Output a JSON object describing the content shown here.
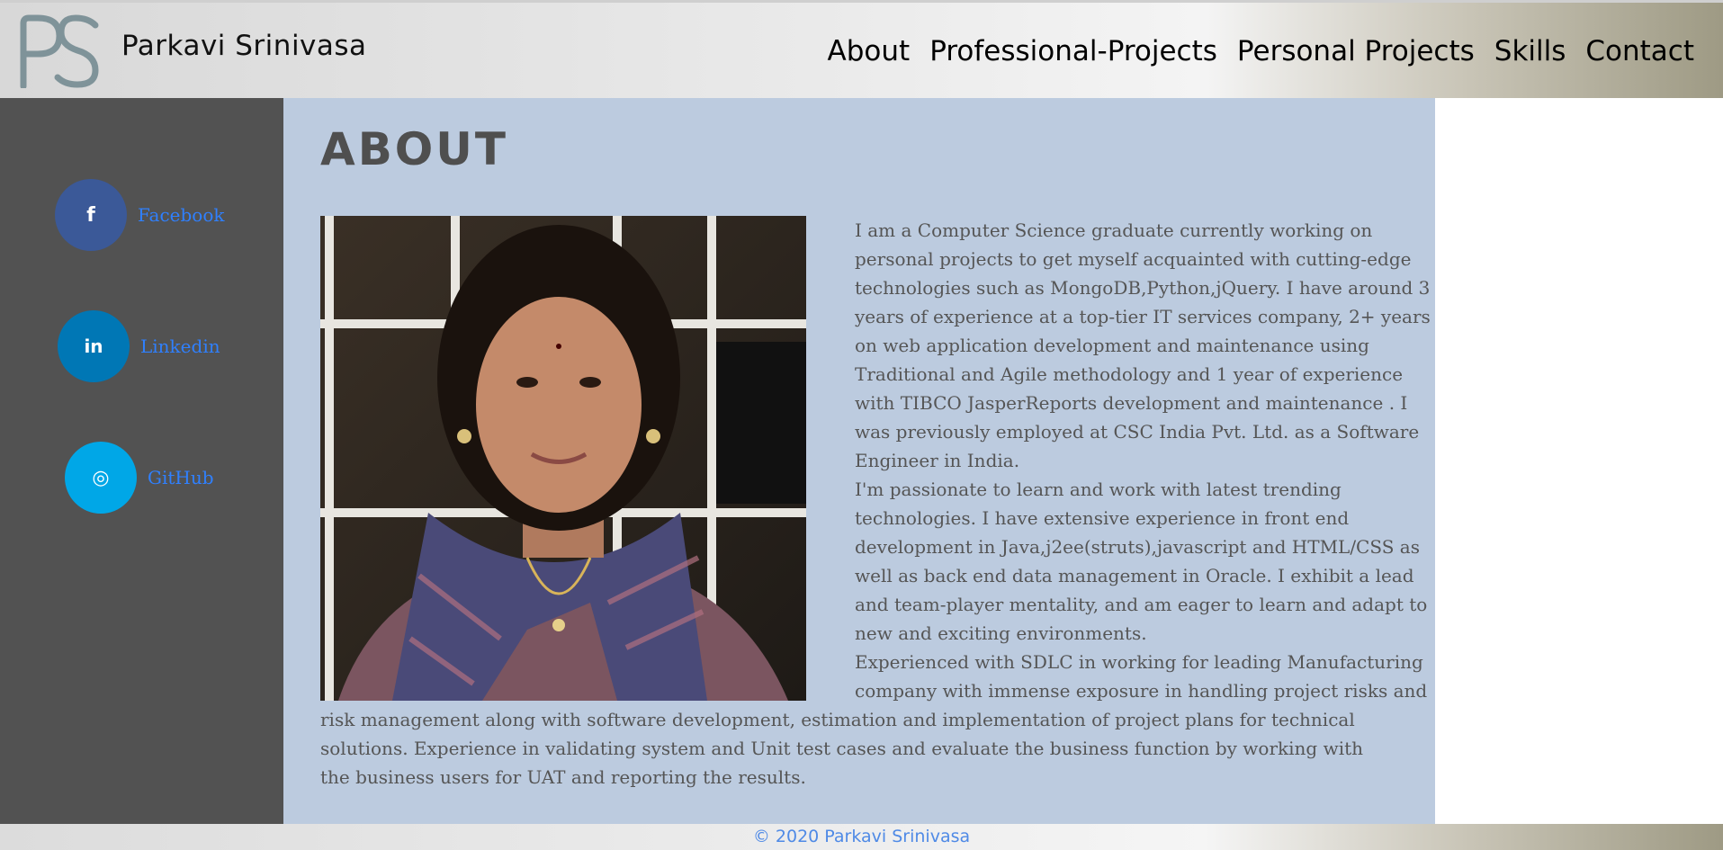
{
  "header": {
    "logo_text": "PS",
    "site_name": "Parkavi Srinivasa",
    "nav": [
      "About",
      "Professional-Projects",
      "Personal Projects",
      "Skills",
      "Contact"
    ]
  },
  "sidebar": {
    "social": [
      {
        "label": "Facebook",
        "glyph": "f",
        "icon": "facebook-icon",
        "color": "#3b5998"
      },
      {
        "label": "Linkedin",
        "glyph": "in",
        "icon": "linkedin-icon",
        "color": "#0077b5"
      },
      {
        "label": "GitHub",
        "glyph": "◎",
        "icon": "github-icon",
        "color": "#00a7e7"
      }
    ]
  },
  "main": {
    "heading": "ABOUT",
    "paragraphs": [
      "I am a Computer Science graduate currently working on personal projects to get myself acquainted with cutting-edge technologies such as MongoDB,Python,jQuery. I have around 3 years of experience at a top-tier IT services company, 2+ years on web application development and maintenance using Traditional and Agile methodology and 1 year of experience with TIBCO JasperReports development and maintenance . I was previously employed at CSC India Pvt. Ltd. as a Software Engineer in India.",
      "I'm passionate to learn and work with latest trending technologies. I have extensive experience in front end development in Java,j2ee(struts),javascript and HTML/CSS as well as back end data management in Oracle. I exhibit a lead and team-player mentality, and am eager to learn and adapt to new and exciting environments.",
      "Experienced with SDLC in working for leading Manufacturing company with immense exposure in handling project risks and",
      "risk management along with software development, estimation and implementation of project plans for technical solutions. Experience in validating system and Unit test cases and evaluate the business function by working with the business users for UAT and reporting the results."
    ]
  },
  "footer": {
    "copyright": "© 2020 Parkavi Srinivasa"
  },
  "colors": {
    "sidebar_bg": "#525252",
    "main_bg": "#bccbdf",
    "link": "#2f80ff",
    "footer_text": "#4f8ae6"
  }
}
